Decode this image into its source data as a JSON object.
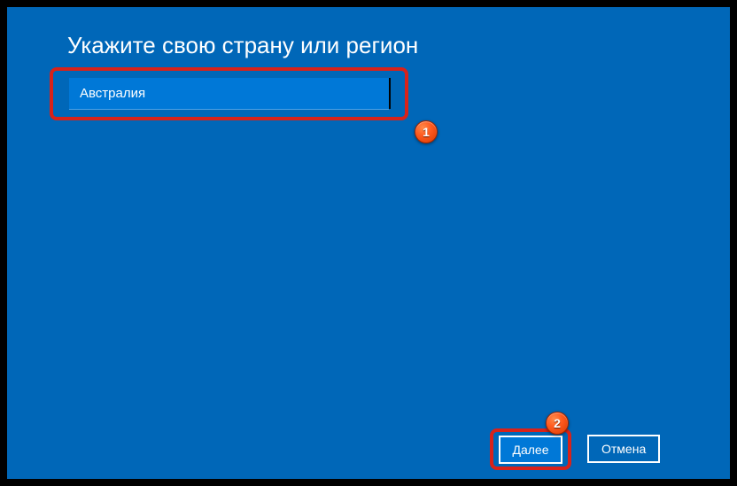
{
  "title": "Укажите свою страну или регион",
  "region": {
    "selected": "Австралия"
  },
  "buttons": {
    "next": "Далее",
    "cancel": "Отмена"
  },
  "markers": {
    "one": "1",
    "two": "2"
  }
}
